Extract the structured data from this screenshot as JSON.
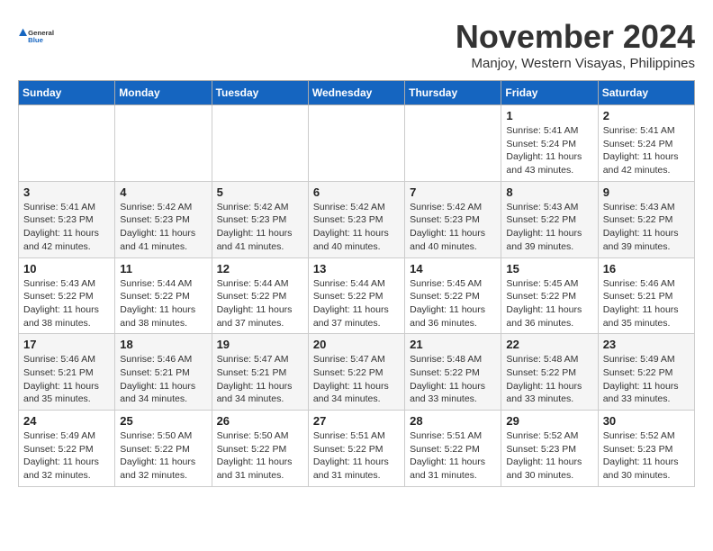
{
  "header": {
    "logo_line1": "General",
    "logo_line2": "Blue",
    "month_title": "November 2024",
    "location": "Manjoy, Western Visayas, Philippines"
  },
  "days_of_week": [
    "Sunday",
    "Monday",
    "Tuesday",
    "Wednesday",
    "Thursday",
    "Friday",
    "Saturday"
  ],
  "weeks": [
    [
      {
        "day": "",
        "info": ""
      },
      {
        "day": "",
        "info": ""
      },
      {
        "day": "",
        "info": ""
      },
      {
        "day": "",
        "info": ""
      },
      {
        "day": "",
        "info": ""
      },
      {
        "day": "1",
        "info": "Sunrise: 5:41 AM\nSunset: 5:24 PM\nDaylight: 11 hours\nand 43 minutes."
      },
      {
        "day": "2",
        "info": "Sunrise: 5:41 AM\nSunset: 5:24 PM\nDaylight: 11 hours\nand 42 minutes."
      }
    ],
    [
      {
        "day": "3",
        "info": "Sunrise: 5:41 AM\nSunset: 5:23 PM\nDaylight: 11 hours\nand 42 minutes."
      },
      {
        "day": "4",
        "info": "Sunrise: 5:42 AM\nSunset: 5:23 PM\nDaylight: 11 hours\nand 41 minutes."
      },
      {
        "day": "5",
        "info": "Sunrise: 5:42 AM\nSunset: 5:23 PM\nDaylight: 11 hours\nand 41 minutes."
      },
      {
        "day": "6",
        "info": "Sunrise: 5:42 AM\nSunset: 5:23 PM\nDaylight: 11 hours\nand 40 minutes."
      },
      {
        "day": "7",
        "info": "Sunrise: 5:42 AM\nSunset: 5:23 PM\nDaylight: 11 hours\nand 40 minutes."
      },
      {
        "day": "8",
        "info": "Sunrise: 5:43 AM\nSunset: 5:22 PM\nDaylight: 11 hours\nand 39 minutes."
      },
      {
        "day": "9",
        "info": "Sunrise: 5:43 AM\nSunset: 5:22 PM\nDaylight: 11 hours\nand 39 minutes."
      }
    ],
    [
      {
        "day": "10",
        "info": "Sunrise: 5:43 AM\nSunset: 5:22 PM\nDaylight: 11 hours\nand 38 minutes."
      },
      {
        "day": "11",
        "info": "Sunrise: 5:44 AM\nSunset: 5:22 PM\nDaylight: 11 hours\nand 38 minutes."
      },
      {
        "day": "12",
        "info": "Sunrise: 5:44 AM\nSunset: 5:22 PM\nDaylight: 11 hours\nand 37 minutes."
      },
      {
        "day": "13",
        "info": "Sunrise: 5:44 AM\nSunset: 5:22 PM\nDaylight: 11 hours\nand 37 minutes."
      },
      {
        "day": "14",
        "info": "Sunrise: 5:45 AM\nSunset: 5:22 PM\nDaylight: 11 hours\nand 36 minutes."
      },
      {
        "day": "15",
        "info": "Sunrise: 5:45 AM\nSunset: 5:22 PM\nDaylight: 11 hours\nand 36 minutes."
      },
      {
        "day": "16",
        "info": "Sunrise: 5:46 AM\nSunset: 5:21 PM\nDaylight: 11 hours\nand 35 minutes."
      }
    ],
    [
      {
        "day": "17",
        "info": "Sunrise: 5:46 AM\nSunset: 5:21 PM\nDaylight: 11 hours\nand 35 minutes."
      },
      {
        "day": "18",
        "info": "Sunrise: 5:46 AM\nSunset: 5:21 PM\nDaylight: 11 hours\nand 34 minutes."
      },
      {
        "day": "19",
        "info": "Sunrise: 5:47 AM\nSunset: 5:21 PM\nDaylight: 11 hours\nand 34 minutes."
      },
      {
        "day": "20",
        "info": "Sunrise: 5:47 AM\nSunset: 5:22 PM\nDaylight: 11 hours\nand 34 minutes."
      },
      {
        "day": "21",
        "info": "Sunrise: 5:48 AM\nSunset: 5:22 PM\nDaylight: 11 hours\nand 33 minutes."
      },
      {
        "day": "22",
        "info": "Sunrise: 5:48 AM\nSunset: 5:22 PM\nDaylight: 11 hours\nand 33 minutes."
      },
      {
        "day": "23",
        "info": "Sunrise: 5:49 AM\nSunset: 5:22 PM\nDaylight: 11 hours\nand 33 minutes."
      }
    ],
    [
      {
        "day": "24",
        "info": "Sunrise: 5:49 AM\nSunset: 5:22 PM\nDaylight: 11 hours\nand 32 minutes."
      },
      {
        "day": "25",
        "info": "Sunrise: 5:50 AM\nSunset: 5:22 PM\nDaylight: 11 hours\nand 32 minutes."
      },
      {
        "day": "26",
        "info": "Sunrise: 5:50 AM\nSunset: 5:22 PM\nDaylight: 11 hours\nand 31 minutes."
      },
      {
        "day": "27",
        "info": "Sunrise: 5:51 AM\nSunset: 5:22 PM\nDaylight: 11 hours\nand 31 minutes."
      },
      {
        "day": "28",
        "info": "Sunrise: 5:51 AM\nSunset: 5:22 PM\nDaylight: 11 hours\nand 31 minutes."
      },
      {
        "day": "29",
        "info": "Sunrise: 5:52 AM\nSunset: 5:23 PM\nDaylight: 11 hours\nand 30 minutes."
      },
      {
        "day": "30",
        "info": "Sunrise: 5:52 AM\nSunset: 5:23 PM\nDaylight: 11 hours\nand 30 minutes."
      }
    ]
  ]
}
